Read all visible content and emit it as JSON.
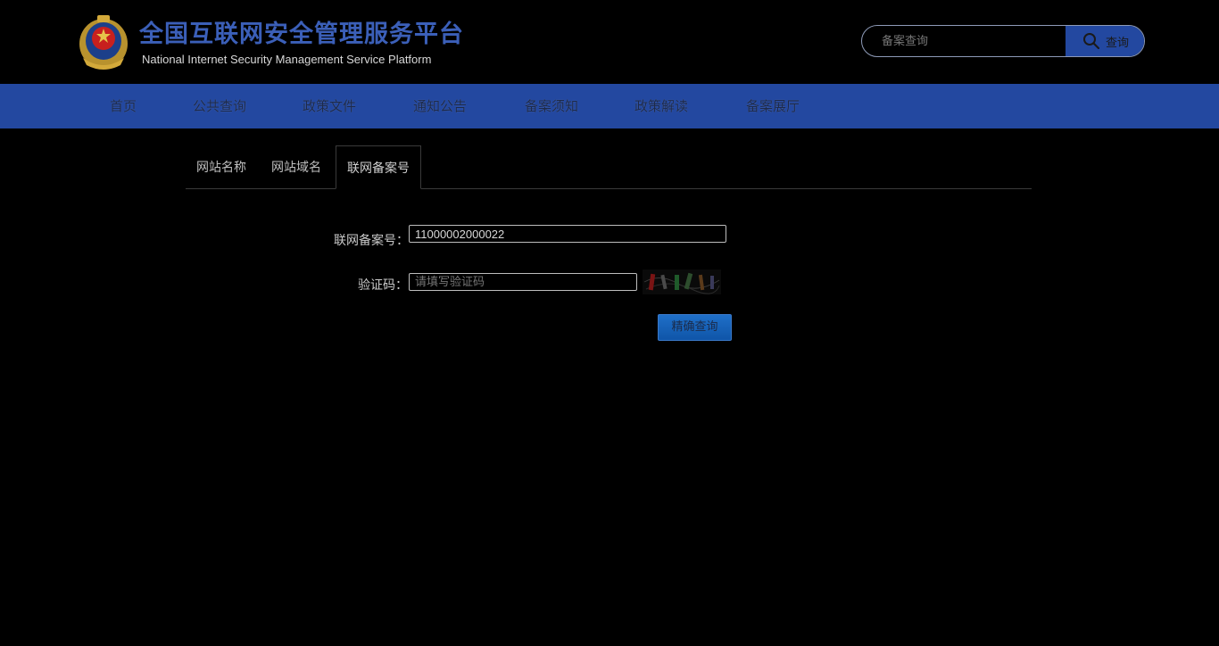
{
  "header": {
    "title_cn": "全国互联网安全管理服务平台",
    "title_en": "National Internet Security Management Service Platform",
    "emblem_icon": "police-emblem-icon",
    "search": {
      "placeholder": "备案查询",
      "value": "",
      "button_label": "查询",
      "button_icon": "search-icon"
    }
  },
  "nav": {
    "items": [
      {
        "label": "首页"
      },
      {
        "label": "公共查询"
      },
      {
        "label": "政策文件"
      },
      {
        "label": "通知公告"
      },
      {
        "label": "备案须知"
      },
      {
        "label": "政策解读"
      },
      {
        "label": "备案展厅"
      }
    ]
  },
  "tabs": {
    "items": [
      {
        "label": "网站名称"
      },
      {
        "label": "网站域名"
      },
      {
        "label": "联网备案号"
      }
    ],
    "active_index": 2
  },
  "form": {
    "record_label": "联网备案号：",
    "record_value": "11000002000022",
    "captcha_label": "验证码：",
    "captcha_placeholder": "请填写验证码",
    "captcha_value": "",
    "submit_label": "精确查询"
  },
  "colors": {
    "nav_bg": "#2348a0",
    "title": "#3b5fb8",
    "button": "#1f6fc8"
  }
}
